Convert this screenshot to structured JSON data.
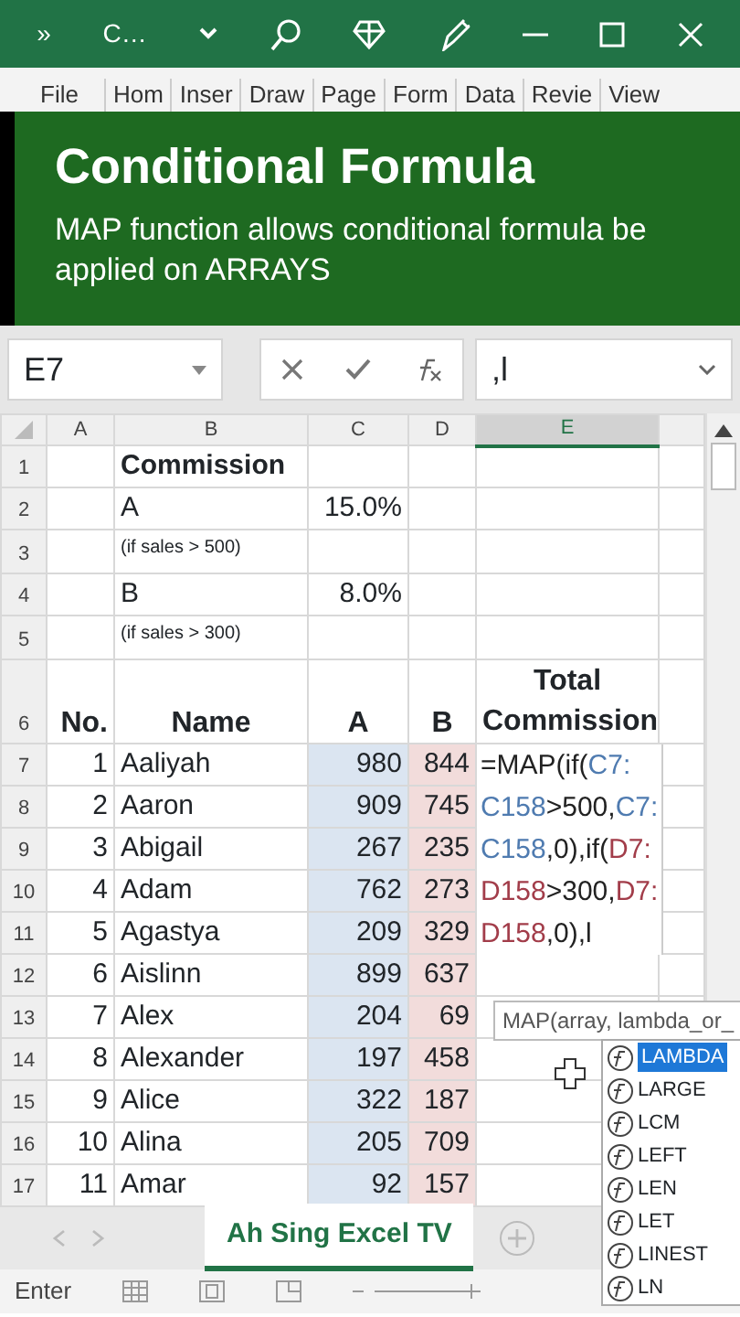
{
  "title_bar": {
    "more": "»",
    "doc_title": "C…"
  },
  "ribbon_tabs": [
    "File",
    "Hom",
    "Inser",
    "Draw",
    "Page",
    "Form",
    "Data",
    "Revie",
    "View"
  ],
  "banner": {
    "title": "Conditional Formula",
    "subtitle": "MAP function allows conditional formula be applied on ARRAYS"
  },
  "formula_bar": {
    "name_box": "E7",
    "formula": ",l"
  },
  "columns": [
    {
      "label": "A",
      "selected": false
    },
    {
      "label": "B",
      "selected": false
    },
    {
      "label": "C",
      "selected": false
    },
    {
      "label": "D",
      "selected": false
    },
    {
      "label": "E",
      "selected": true
    }
  ],
  "top_rows": [
    {
      "row": "1",
      "kind": "title",
      "b": "Commission",
      "c": ""
    },
    {
      "row": "2",
      "kind": "rate",
      "b": "A",
      "c": "15.0%"
    },
    {
      "row": "3",
      "kind": "note",
      "b": "(if sales > 500)",
      "c": ""
    },
    {
      "row": "4",
      "kind": "rate",
      "b": "B",
      "c": "8.0%"
    },
    {
      "row": "5",
      "kind": "note",
      "b": "(if sales > 300)",
      "c": ""
    }
  ],
  "header_row": {
    "row": "6",
    "cells": [
      "No.",
      "Name",
      "A",
      "B",
      "Total Commission"
    ]
  },
  "data_rows": [
    {
      "row": "7",
      "no": "1",
      "name": "Aaliyah",
      "a": "980",
      "b": "844"
    },
    {
      "row": "8",
      "no": "2",
      "name": "Aaron",
      "a": "909",
      "b": "745"
    },
    {
      "row": "9",
      "no": "3",
      "name": "Abigail",
      "a": "267",
      "b": "235"
    },
    {
      "row": "10",
      "no": "4",
      "name": "Adam",
      "a": "762",
      "b": "273"
    },
    {
      "row": "11",
      "no": "5",
      "name": "Agastya",
      "a": "209",
      "b": "329"
    },
    {
      "row": "12",
      "no": "6",
      "name": "Aislinn",
      "a": "899",
      "b": "637"
    },
    {
      "row": "13",
      "no": "7",
      "name": "Alex",
      "a": "204",
      "b": "69"
    },
    {
      "row": "14",
      "no": "8",
      "name": "Alexander",
      "a": "197",
      "b": "458"
    },
    {
      "row": "15",
      "no": "9",
      "name": "Alice",
      "a": "322",
      "b": "187"
    },
    {
      "row": "16",
      "no": "10",
      "name": "Alina",
      "a": "205",
      "b": "709"
    },
    {
      "row": "17",
      "no": "11",
      "name": "Amar",
      "a": "92",
      "b": "157"
    }
  ],
  "cell_formula": [
    [
      {
        "text": "=MAP(if(",
        "color": "#222222"
      },
      {
        "text": "C7:",
        "color": "#4f7bb0"
      }
    ],
    [
      {
        "text": "C158",
        "color": "#4f7bb0"
      },
      {
        "text": ">500,",
        "color": "#222222"
      },
      {
        "text": "C7:",
        "color": "#4f7bb0"
      }
    ],
    [
      {
        "text": "C158",
        "color": "#4f7bb0"
      },
      {
        "text": ",0),if(",
        "color": "#222222"
      },
      {
        "text": "D7:",
        "color": "#a23d4a"
      }
    ],
    [
      {
        "text": "D158",
        "color": "#a23d4a"
      },
      {
        "text": ">300,",
        "color": "#222222"
      },
      {
        "text": "D7:",
        "color": "#a23d4a"
      }
    ],
    [
      {
        "text": "D158",
        "color": "#a23d4a"
      },
      {
        "text": ",0),l",
        "color": "#222222"
      }
    ]
  ],
  "tooltip": "MAP(array, lambda_or_",
  "autocomplete": [
    {
      "label": "LAMBDA",
      "selected": true
    },
    {
      "label": "LARGE",
      "selected": false
    },
    {
      "label": "LCM",
      "selected": false
    },
    {
      "label": "LEFT",
      "selected": false
    },
    {
      "label": "LEN",
      "selected": false
    },
    {
      "label": "LET",
      "selected": false
    },
    {
      "label": "LINEST",
      "selected": false
    },
    {
      "label": "LN",
      "selected": false
    }
  ],
  "sheet_tab": "Ah Sing Excel TV",
  "status": "Enter"
}
